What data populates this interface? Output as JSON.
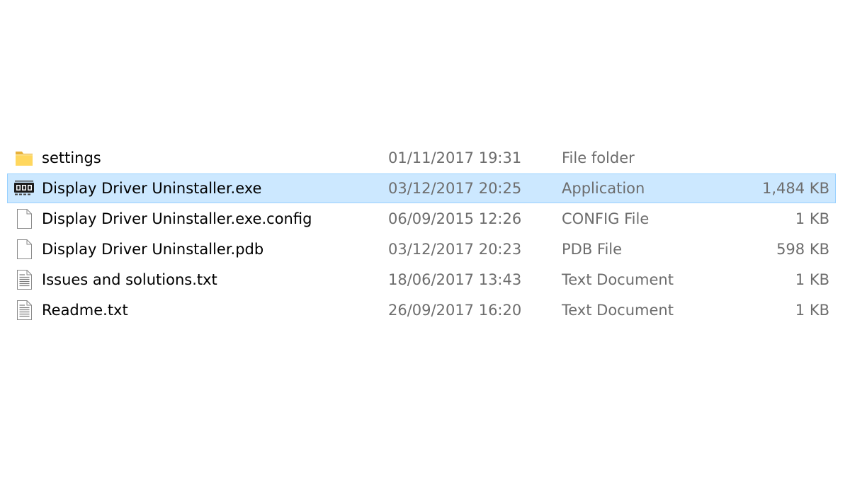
{
  "files": [
    {
      "name": "settings",
      "modified": "01/11/2017 19:31",
      "type": "File folder",
      "size": "",
      "icon": "folder-icon",
      "selected": false
    },
    {
      "name": "Display Driver Uninstaller.exe",
      "modified": "03/12/2017 20:25",
      "type": "Application",
      "size": "1,484 KB",
      "icon": "application-icon",
      "selected": true
    },
    {
      "name": "Display Driver Uninstaller.exe.config",
      "modified": "06/09/2015 12:26",
      "type": "CONFIG File",
      "size": "1 KB",
      "icon": "blank-file-icon",
      "selected": false
    },
    {
      "name": "Display Driver Uninstaller.pdb",
      "modified": "03/12/2017 20:23",
      "type": "PDB File",
      "size": "598 KB",
      "icon": "blank-file-icon",
      "selected": false
    },
    {
      "name": "Issues and solutions.txt",
      "modified": "18/06/2017 13:43",
      "type": "Text Document",
      "size": "1 KB",
      "icon": "text-file-icon",
      "selected": false
    },
    {
      "name": "Readme.txt",
      "modified": "26/09/2017 16:20",
      "type": "Text Document",
      "size": "1 KB",
      "icon": "text-file-icon",
      "selected": false
    }
  ],
  "colors": {
    "selection_background": "#cce8ff",
    "selection_border": "#99d1ff",
    "folder": "#ffd75e",
    "detail_text": "#6d6d6d"
  }
}
